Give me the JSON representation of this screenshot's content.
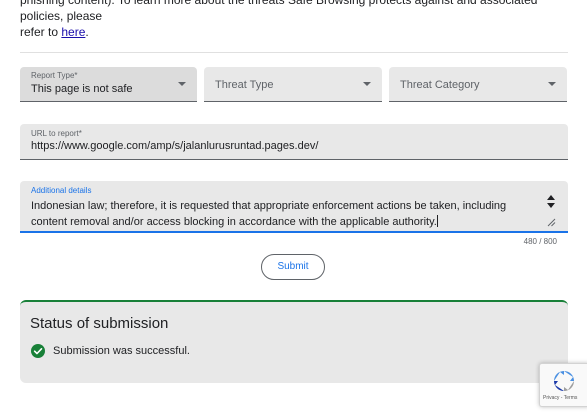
{
  "intro": {
    "line1": "phishing content). To learn more about the threats Safe Browsing protects against and associated policies, please",
    "line2_prefix": "refer to ",
    "link": "here",
    "line2_suffix": "."
  },
  "form": {
    "report_type": {
      "label": "Report Type*",
      "value": "This page is not safe"
    },
    "threat_type": {
      "placeholder": "Threat Type"
    },
    "threat_category": {
      "placeholder": "Threat Category"
    },
    "url": {
      "label": "URL to report*",
      "value": "https://www.google.com/amp/s/jalanlurusruntad.pages.dev/"
    },
    "details": {
      "label": "Additional details",
      "line1": "Indonesian law; therefore, it is requested that appropriate enforcement actions be taken, including",
      "line2": "content removal and/or access blocking in accordance with the applicable authority.",
      "counter": "480 / 800"
    },
    "submit_label": "Submit"
  },
  "status": {
    "title": "Status of submission",
    "message": "Submission was successful."
  },
  "recaptcha": {
    "terms": "Privacy - Terms"
  },
  "colors": {
    "accent": "#1a73e8",
    "success": "#188038",
    "field_bg": "#e8e8e8"
  },
  "icons": {
    "dropdown": "caret-down-icon",
    "success": "check-circle-icon",
    "badge": "recaptcha-icon"
  }
}
